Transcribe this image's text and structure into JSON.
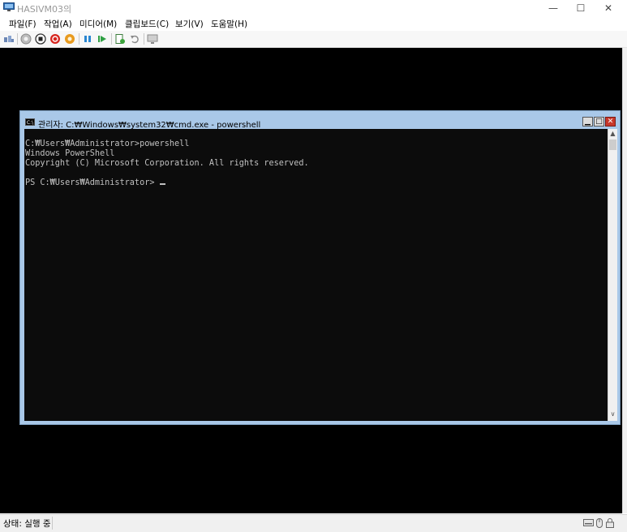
{
  "window": {
    "title": "HASIVM03의",
    "minimize_glyph": "—",
    "maximize_glyph": "☐",
    "close_glyph": "✕"
  },
  "menu": [
    "파일(F)",
    "작업(A)",
    "미디어(M)",
    "클립보드(C)",
    "보기(V)",
    "도움말(H)"
  ],
  "toolbar_icons": [
    "ctrl-alt-del-icon",
    "start-icon",
    "turn-off-icon",
    "shutdown-icon",
    "save-icon",
    "reset-icon",
    "pause-icon",
    "resume-icon",
    "checkpoint-icon",
    "revert-icon",
    "enhanced-session-icon"
  ],
  "cmd": {
    "title": "관리자: C:₩Windows₩system32₩cmd.exe - powershell",
    "lines": [
      "C:₩Users₩Administrator>powershell",
      "Windows PowerShell",
      "Copyright (C) Microsoft Corporation. All rights reserved.",
      "",
      "PS C:₩Users₩Administrator> "
    ],
    "min_glyph": "▁",
    "max_glyph": "□",
    "close_glyph": "✕",
    "scroll_up_glyph": "▲",
    "scroll_down_glyph": "∨"
  },
  "status": {
    "text": "상태: 실행 중"
  },
  "colors": {
    "cmd_frame": "#a9c8e8",
    "console_bg": "#0c0c0c",
    "console_text": "#c0c0c0",
    "close_red": "#c8382b"
  }
}
